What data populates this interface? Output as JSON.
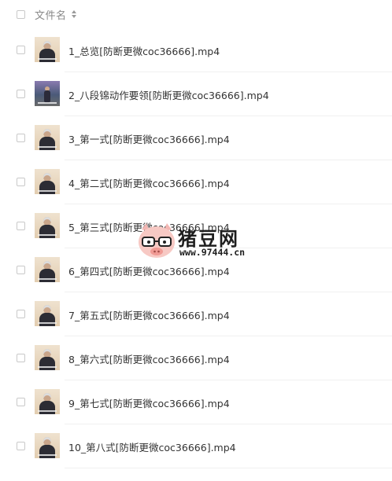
{
  "header": {
    "column_label": "文件名"
  },
  "files": [
    {
      "name": "1_总览[防断更微coc36666].mp4",
      "thumb": "indoor"
    },
    {
      "name": "2_八段锦动作要领[防断更微coc36666].mp4",
      "thumb": "outdoor"
    },
    {
      "name": "3_第一式[防断更微coc36666].mp4",
      "thumb": "indoor"
    },
    {
      "name": "4_第二式[防断更微coc36666].mp4",
      "thumb": "indoor"
    },
    {
      "name": "5_第三式[防断更微coc36666].mp4",
      "thumb": "indoor"
    },
    {
      "name": "6_第四式[防断更微coc36666].mp4",
      "thumb": "indoor"
    },
    {
      "name": "7_第五式[防断更微coc36666].mp4",
      "thumb": "indoor"
    },
    {
      "name": "8_第六式[防断更微coc36666].mp4",
      "thumb": "indoor"
    },
    {
      "name": "9_第七式[防断更微coc36666].mp4",
      "thumb": "indoor"
    },
    {
      "name": "10_第八式[防断更微coc36666].mp4",
      "thumb": "indoor"
    }
  ],
  "watermark": {
    "title": "猪豆网",
    "url": "www.97444.cn"
  },
  "colors": {
    "text": "#333333",
    "header_text": "#888888",
    "checkbox_border": "#c9c9c9",
    "divider": "#f0f0f0",
    "pig_pink": "#f3b7b3"
  }
}
